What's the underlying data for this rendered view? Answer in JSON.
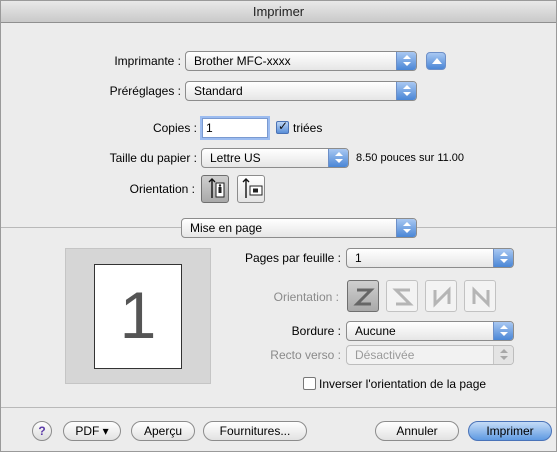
{
  "window": {
    "title": "Imprimer"
  },
  "printer": {
    "label": "Imprimante :",
    "value": "Brother MFC-xxxx"
  },
  "presets": {
    "label": "Préréglages :",
    "value": "Standard"
  },
  "copies": {
    "label": "Copies :",
    "value": "1",
    "collated_label": "triées",
    "collated": true
  },
  "paper": {
    "label": "Taille du papier :",
    "value": "Lettre US",
    "size_text": "8.50 pouces sur 11.00"
  },
  "orientation": {
    "label": "Orientation :",
    "options": [
      "portrait-icon",
      "landscape-icon"
    ],
    "selected": 0
  },
  "panel_menu": {
    "value": "Mise en page"
  },
  "preview": {
    "page_number": "1"
  },
  "layout": {
    "pages_per_sheet_label": "Pages par feuille :",
    "pages_per_sheet_value": "1",
    "orientation_label": "Orientation :",
    "orientation_icons": [
      "layout-z-icon",
      "layout-s-icon",
      "layout-n-reverse-icon",
      "layout-n-icon"
    ],
    "border_label": "Bordure :",
    "border_value": "Aucune",
    "duplex_label": "Recto verso :",
    "duplex_value": "Désactivée",
    "reverse_label": "Inverser l'orientation de la page",
    "reverse_checked": false
  },
  "footer": {
    "help_label": "?",
    "pdf_label": "PDF ▾",
    "preview_label": "Aperçu",
    "supplies_label": "Fournitures...",
    "cancel_label": "Annuler",
    "print_label": "Imprimer"
  },
  "colors": {
    "accent": "#5f9ae2",
    "window_bg": "#ececec"
  }
}
